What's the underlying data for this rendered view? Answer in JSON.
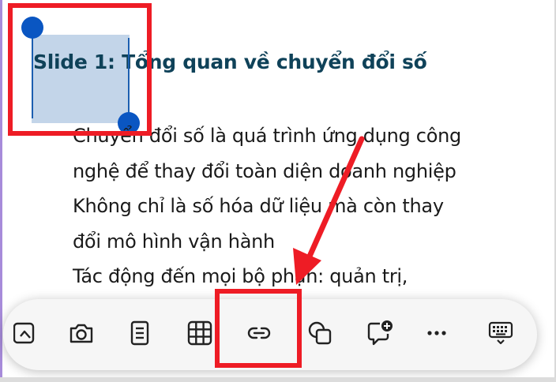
{
  "slide": {
    "title": "Slide 1: Tổng quan về chuyển đổi số",
    "body_lines": [
      "Chuyển đổi số là quá trình ứng dụng công",
      "nghệ để thay đổi toàn diện doanh nghiệp",
      "Không chỉ là số hóa dữ liệu mà còn thay",
      "đổi mô hình vận hành",
      "Tác động đến mọi bộ phận: quản trị,"
    ]
  },
  "toolbar": {
    "items": [
      {
        "icon": "picture-icon"
      },
      {
        "icon": "camera-icon"
      },
      {
        "icon": "document-icon"
      },
      {
        "icon": "table-icon"
      },
      {
        "icon": "link-icon"
      },
      {
        "icon": "shapes-icon"
      },
      {
        "icon": "add-comment-icon"
      },
      {
        "icon": "more-icon"
      },
      {
        "icon": "keyboard-icon"
      }
    ]
  },
  "colors": {
    "title": "#0f4259",
    "selection_handle": "#0a56c2",
    "annotation": "#ee1c25",
    "toolbar_bg": "#f6f6f6"
  }
}
